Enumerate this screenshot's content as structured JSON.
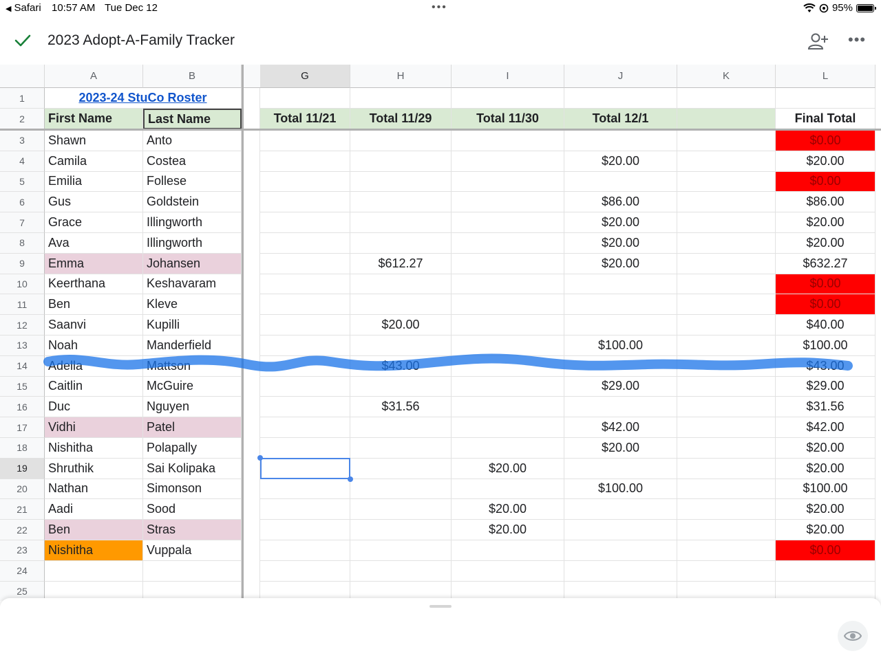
{
  "status_bar": {
    "back_app": "Safari",
    "time": "10:57 AM",
    "date": "Tue Dec 12",
    "battery": "95%"
  },
  "doc": {
    "title": "2023 Adopt-A-Family Tracker"
  },
  "columns": [
    "A",
    "B",
    "G",
    "H",
    "I",
    "J",
    "K",
    "L"
  ],
  "selected_column": "G",
  "roster_link": "2023-24 StuCo Roster",
  "headers": {
    "first": "First Name",
    "last": "Last Name",
    "g": "Total 11/21",
    "h": "Total 11/29",
    "i": "Total 11/30",
    "j": "Total 12/1",
    "k": "",
    "l": "Final Total"
  },
  "rows": [
    {
      "n": "3",
      "first": "Shawn",
      "last": "Anto",
      "g": "",
      "h": "",
      "i": "",
      "j": "",
      "k": "",
      "l": "$0.00"
    },
    {
      "n": "4",
      "first": "Camila",
      "last": "Costea",
      "g": "",
      "h": "",
      "i": "",
      "j": "$20.00",
      "k": "",
      "l": "$20.00"
    },
    {
      "n": "5",
      "first": "Emilia",
      "last": "Follese",
      "g": "",
      "h": "",
      "i": "",
      "j": "",
      "k": "",
      "l": "$0.00"
    },
    {
      "n": "6",
      "first": "Gus",
      "last": "Goldstein",
      "g": "",
      "h": "",
      "i": "",
      "j": "$86.00",
      "k": "",
      "l": "$86.00"
    },
    {
      "n": "7",
      "first": "Grace",
      "last": "Illingworth",
      "g": "",
      "h": "",
      "i": "",
      "j": "$20.00",
      "k": "",
      "l": "$20.00"
    },
    {
      "n": "8",
      "first": "Ava",
      "last": "Illingworth",
      "g": "",
      "h": "",
      "i": "",
      "j": "$20.00",
      "k": "",
      "l": "$20.00"
    },
    {
      "n": "9",
      "first": "Emma",
      "last": "Johansen",
      "g": "",
      "h": "$612.27",
      "i": "",
      "j": "$20.00",
      "k": "",
      "l": "$632.27"
    },
    {
      "n": "10",
      "first": "Keerthana",
      "last": "Keshavaram",
      "g": "",
      "h": "",
      "i": "",
      "j": "",
      "k": "",
      "l": "$0.00"
    },
    {
      "n": "11",
      "first": "Ben",
      "last": "Kleve",
      "g": "",
      "h": "",
      "i": "",
      "j": "",
      "k": "",
      "l": "$0.00"
    },
    {
      "n": "12",
      "first": "Saanvi",
      "last": "Kupilli",
      "g": "",
      "h": "$20.00",
      "i": "",
      "j": "",
      "k": "",
      "l": "$40.00"
    },
    {
      "n": "13",
      "first": "Noah",
      "last": "Manderfield",
      "g": "",
      "h": "",
      "i": "",
      "j": "$100.00",
      "k": "",
      "l": "$100.00"
    },
    {
      "n": "14",
      "first": "Adella",
      "last": "Mattson",
      "g": "",
      "h": "$43.00",
      "i": "",
      "j": "",
      "k": "",
      "l": "$43.00"
    },
    {
      "n": "15",
      "first": "Caitlin",
      "last": "McGuire",
      "g": "",
      "h": "",
      "i": "",
      "j": "$29.00",
      "k": "",
      "l": "$29.00"
    },
    {
      "n": "16",
      "first": "Duc",
      "last": "Nguyen",
      "g": "",
      "h": "$31.56",
      "i": "",
      "j": "",
      "k": "",
      "l": "$31.56"
    },
    {
      "n": "17",
      "first": "Vidhi",
      "last": "Patel",
      "g": "",
      "h": "",
      "i": "",
      "j": "$42.00",
      "k": "",
      "l": "$42.00"
    },
    {
      "n": "18",
      "first": "Nishitha",
      "last": "Polapally",
      "g": "",
      "h": "",
      "i": "",
      "j": "$20.00",
      "k": "",
      "l": "$20.00"
    },
    {
      "n": "19",
      "first": "Shruthik",
      "last": "Sai Kolipaka",
      "g": "",
      "h": "",
      "i": "$20.00",
      "j": "",
      "k": "",
      "l": "$20.00"
    },
    {
      "n": "20",
      "first": "Nathan",
      "last": "Simonson",
      "g": "",
      "h": "",
      "i": "",
      "j": "$100.00",
      "k": "",
      "l": "$100.00"
    },
    {
      "n": "21",
      "first": "Aadi",
      "last": "Sood",
      "g": "",
      "h": "",
      "i": "$20.00",
      "j": "",
      "k": "",
      "l": "$20.00"
    },
    {
      "n": "22",
      "first": "Ben",
      "last": "Stras",
      "g": "",
      "h": "",
      "i": "$20.00",
      "j": "",
      "k": "",
      "l": "$20.00"
    },
    {
      "n": "23",
      "first": "Nishitha",
      "last": "Vuppala",
      "g": "",
      "h": "",
      "i": "",
      "j": "",
      "k": "",
      "l": "$0.00"
    },
    {
      "n": "24",
      "first": "",
      "last": "",
      "g": "",
      "h": "",
      "i": "",
      "j": "",
      "k": "",
      "l": ""
    },
    {
      "n": "25",
      "first": "",
      "last": "",
      "g": "",
      "h": "",
      "i": "",
      "j": "",
      "k": "",
      "l": ""
    }
  ],
  "styles": {
    "header_fill": "#d9ead3",
    "zero_fill": "#ff0000",
    "highlight_pink": "#ead1dc",
    "highlight_orange": "#ff9900",
    "markup_stroke": "#1a73e8"
  },
  "highlighted_rows": {
    "pink": [
      "9",
      "17",
      "22"
    ],
    "orange_first": [
      "23"
    ]
  },
  "zero_rows": [
    "3",
    "5",
    "10",
    "11",
    "23"
  ],
  "selected_cell": "G19",
  "struck_row": "14",
  "icons": [
    "checkmark-icon",
    "add-person-icon",
    "more-horizontal-icon",
    "wifi-icon",
    "location-icon",
    "battery-icon",
    "eye-icon"
  ]
}
